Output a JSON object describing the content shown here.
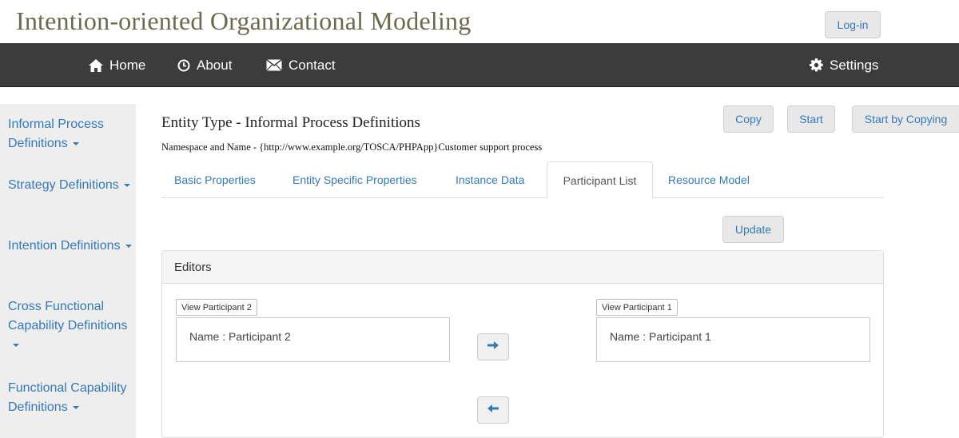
{
  "app": {
    "title": "Intention-oriented Organizational Modeling",
    "login_label": "Log-in"
  },
  "navbar": {
    "home": "Home",
    "about": "About",
    "contact": "Contact",
    "settings": "Settings"
  },
  "sidebar": {
    "items": [
      {
        "label": "Informal Process Definitions"
      },
      {
        "label": "Strategy Definitions"
      },
      {
        "label": "Intention Definitions"
      },
      {
        "label": "Cross Functional Capability Definitions"
      },
      {
        "label": "Functional Capability Definitions"
      }
    ]
  },
  "entity": {
    "title": "Entity Type - Informal Process Definitions",
    "namespace": "Namespace and Name - {http://www.example.org/TOSCA/PHPApp}Customer support process"
  },
  "actions": {
    "copy": "Copy",
    "start": "Start",
    "start_by_copying": "Start by Copying"
  },
  "tabs": [
    {
      "label": "Basic Properties",
      "active": false
    },
    {
      "label": "Entity Specific Properties",
      "active": false
    },
    {
      "label": "Instance Data",
      "active": false
    },
    {
      "label": "Participant List",
      "active": true
    },
    {
      "label": "Resource Model",
      "active": false
    }
  ],
  "update_label": "Update",
  "editors": {
    "heading": "Editors",
    "left": {
      "view_label": "View Participant 2",
      "name_text": "Name : Participant 2"
    },
    "right": {
      "view_label": "View Participant 1",
      "name_text": "Name : Participant 1"
    }
  },
  "colors": {
    "link": "#337ab7",
    "navbar_bg": "#3c3c3c",
    "sidebar_bg": "#eeeeee",
    "title": "#6b6a4e"
  }
}
